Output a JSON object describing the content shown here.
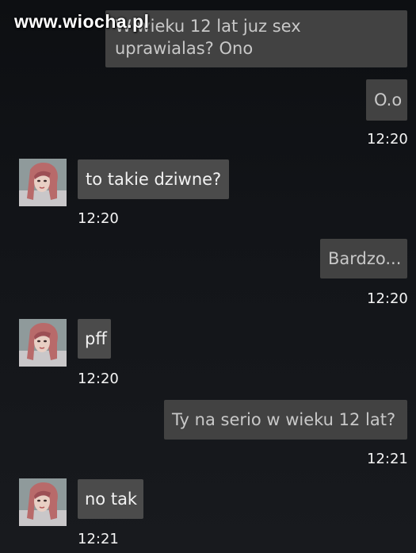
{
  "watermark": "www.wiocha.pl",
  "messages": [
    {
      "direction": "out",
      "text_line1": "W wieku 12 lat juz sex",
      "text_line2": "uprawialas? Ono"
    },
    {
      "direction": "out",
      "text": "O.o",
      "time": "12:20"
    },
    {
      "direction": "in",
      "text": "to takie dziwne?",
      "time": "12:20",
      "avatar": "contact-avatar-photo"
    },
    {
      "direction": "out",
      "text": "Bardzo...",
      "time": "12:20"
    },
    {
      "direction": "in",
      "text": "pff",
      "time": "12:20",
      "avatar": "contact-avatar-photo"
    },
    {
      "direction": "out",
      "text": "Ty na serio w wieku 12 lat?",
      "time": "12:21"
    },
    {
      "direction": "in",
      "text": "no tak",
      "time": "12:21",
      "avatar": "contact-avatar-photo"
    }
  ],
  "colors": {
    "background": "#121418",
    "bubble_out": "#424242",
    "bubble_in": "#4b4b4b",
    "timestamp": "#f5f5f5"
  }
}
